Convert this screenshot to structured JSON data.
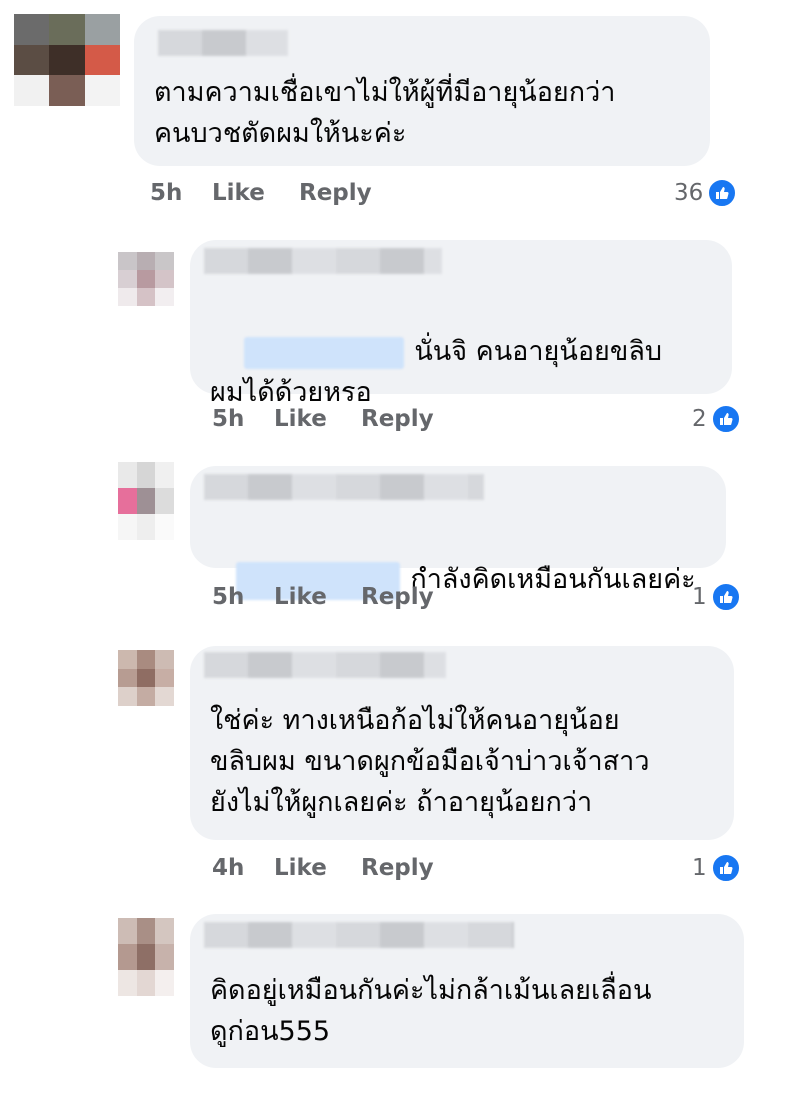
{
  "comments": [
    {
      "text": "ตามความเชื่อเขาไม่ให้ผู้ที่มีอายุน้อยกว่า\nคนบวชตัดผมให้นะค่ะ",
      "time": "5h",
      "like": "Like",
      "reply": "Reply",
      "reactions": "36"
    },
    {
      "text": "นั่นจิ คนอายุน้อยขลิบ\nผมได้ด้วยหรอ",
      "time": "5h",
      "like": "Like",
      "reply": "Reply",
      "reactions": "2"
    },
    {
      "text": "กำลังคิดเหมือนกันเลยค่ะ",
      "time": "5h",
      "like": "Like",
      "reply": "Reply",
      "reactions": "1"
    },
    {
      "text": "ใช่ค่ะ ทางเหนือก้อไม่ให้คนอายุน้อย\nขลิบผม ขนาดผูกข้อมือเจ้าบ่าวเจ้าสาว\nยังไม่ให้ผูกเลยค่ะ ถ้าอายุน้อยกว่า",
      "time": "4h",
      "like": "Like",
      "reply": "Reply",
      "reactions": "1"
    },
    {
      "text": "คิดอยู่เหมือนกันค่ะไม่กล้าเม้นเลยเลื่อน\nดูก่อน555"
    }
  ],
  "icons": {
    "reaction": "thumbs-up-icon"
  },
  "colors": {
    "bubble": "#f0f2f5",
    "like_blue": "#1877f2",
    "meta": "#65676b"
  }
}
